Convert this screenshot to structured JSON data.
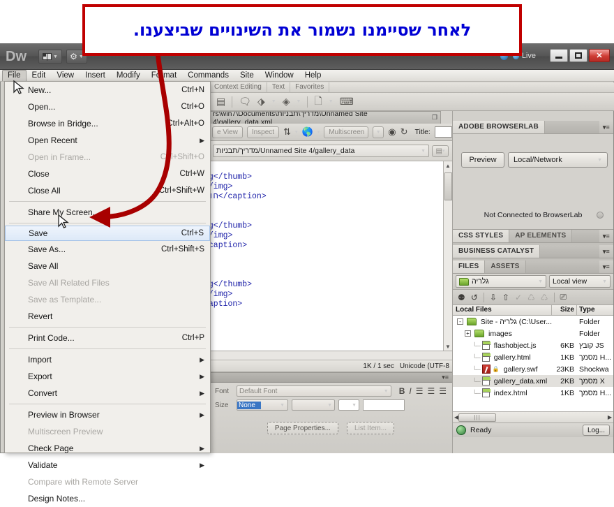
{
  "callout": {
    "text": "לאחר שסיימנו נשמור את השינויים שביצענו."
  },
  "titlebar": {
    "app_abbrev": "Dw",
    "layout_label": "",
    "live_label": "Live",
    "minimize": "",
    "maximize": "",
    "close": "✕"
  },
  "menubar": {
    "items": [
      {
        "label": "File",
        "active": true
      },
      {
        "label": "Edit",
        "active": false
      },
      {
        "label": "View",
        "active": false
      },
      {
        "label": "Insert",
        "active": false
      },
      {
        "label": "Modify",
        "active": false
      },
      {
        "label": "Format",
        "active": false
      },
      {
        "label": "Commands",
        "active": false
      },
      {
        "label": "Site",
        "active": false
      },
      {
        "label": "Window",
        "active": false
      },
      {
        "label": "Help",
        "active": false
      }
    ]
  },
  "file_menu": {
    "items": [
      {
        "label": "New...",
        "accel": "Ctrl+N",
        "disabled": false,
        "submenu": false,
        "selected": false
      },
      {
        "label": "Open...",
        "accel": "Ctrl+O",
        "disabled": false,
        "submenu": false,
        "selected": false
      },
      {
        "label": "Browse in Bridge...",
        "accel": "Ctrl+Alt+O",
        "disabled": false,
        "submenu": false,
        "selected": false
      },
      {
        "label": "Open Recent",
        "accel": "",
        "disabled": false,
        "submenu": true,
        "selected": false
      },
      {
        "label": "Open in Frame...",
        "accel": "Ctrl+Shift+O",
        "disabled": true,
        "submenu": false,
        "selected": false
      },
      {
        "label": "Close",
        "accel": "Ctrl+W",
        "disabled": false,
        "submenu": false,
        "selected": false
      },
      {
        "label": "Close All",
        "accel": "Ctrl+Shift+W",
        "disabled": false,
        "submenu": false,
        "selected": false
      },
      {
        "separator": true
      },
      {
        "label": "Share My Screen...",
        "accel": "",
        "disabled": false,
        "submenu": false,
        "selected": false
      },
      {
        "separator": true
      },
      {
        "label": "Save",
        "accel": "Ctrl+S",
        "disabled": false,
        "submenu": false,
        "selected": true
      },
      {
        "label": "Save As...",
        "accel": "Ctrl+Shift+S",
        "disabled": false,
        "submenu": false,
        "selected": false
      },
      {
        "label": "Save All",
        "accel": "",
        "disabled": false,
        "submenu": false,
        "selected": false
      },
      {
        "label": "Save All Related Files",
        "accel": "",
        "disabled": true,
        "submenu": false,
        "selected": false
      },
      {
        "label": "Save as Template...",
        "accel": "",
        "disabled": true,
        "submenu": false,
        "selected": false
      },
      {
        "label": "Revert",
        "accel": "",
        "disabled": false,
        "submenu": false,
        "selected": false
      },
      {
        "separator": true
      },
      {
        "label": "Print Code...",
        "accel": "Ctrl+P",
        "disabled": false,
        "submenu": false,
        "selected": false
      },
      {
        "separator": true
      },
      {
        "label": "Import",
        "accel": "",
        "disabled": false,
        "submenu": true,
        "selected": false
      },
      {
        "label": "Export",
        "accel": "",
        "disabled": false,
        "submenu": true,
        "selected": false
      },
      {
        "label": "Convert",
        "accel": "",
        "disabled": false,
        "submenu": true,
        "selected": false
      },
      {
        "separator": true
      },
      {
        "label": "Preview in Browser",
        "accel": "",
        "disabled": false,
        "submenu": true,
        "selected": false
      },
      {
        "label": "Multiscreen Preview",
        "accel": "",
        "disabled": true,
        "submenu": false,
        "selected": false
      },
      {
        "label": "Check Page",
        "accel": "",
        "disabled": false,
        "submenu": true,
        "selected": false
      },
      {
        "label": "Validate",
        "accel": "",
        "disabled": false,
        "submenu": true,
        "selected": false
      },
      {
        "label": "Compare with Remote Server",
        "accel": "",
        "disabled": true,
        "submenu": false,
        "selected": false
      },
      {
        "label": "Design Notes...",
        "accel": "",
        "disabled": false,
        "submenu": false,
        "selected": false
      }
    ]
  },
  "insert_bar": {
    "tabs": [
      "Context Editing",
      "Text",
      "Favorites"
    ]
  },
  "document": {
    "tab_path": "rs\\win7\\Documents\\מדריך\\תבניות\\Unnamed Site 4\\gallery_data.xml",
    "toolbar": {
      "live_view": "e View",
      "inspect": "Inspect",
      "multiscreen": "Multiscreen",
      "title_label": "Title:",
      "title_value": ""
    },
    "path_combo": "מדריך/תבניות/Unnamed Site 4/gallery_data",
    "code": "pg</thumb>\n</img>\nחוף</caption>\n\n\npg</thumb>\n</img>\n/caption>\n\n\n\npg</thumb>\n</img>\ncaption>",
    "status": {
      "size_time": "1K / 1 sec",
      "encoding": "Unicode (UTF-8"
    }
  },
  "properties": {
    "font_label": "Font",
    "font_value": "Default Font",
    "size_label": "Size",
    "size_value": "None",
    "page_properties_btn": "Page Properties...",
    "list_item_btn": "List Item..."
  },
  "browserlab": {
    "panel_title": "ADOBE BROWSERLAB",
    "preview_btn": "Preview",
    "mode_value": "Local/Network",
    "status": "Not Connected to BrowserLab"
  },
  "panels": {
    "css_styles": "CSS STYLES",
    "ap_elements": "AP ELEMENTS",
    "business_catalyst": "BUSINESS CATALYST",
    "files_tab": "FILES",
    "assets_tab": "ASSETS"
  },
  "files_panel": {
    "site_value": "גלריה",
    "view_value": "Local view",
    "columns": {
      "name": "Local Files",
      "size": "Size",
      "type": "Type"
    },
    "rows": [
      {
        "name": "Site - גלריה (C:\\User...",
        "size": "",
        "type": "Folder",
        "icon": "folder-icon",
        "indent": 0,
        "expander": "-",
        "selected": false
      },
      {
        "name": "images",
        "size": "",
        "type": "Folder",
        "icon": "folder-icon",
        "indent": 1,
        "expander": "+",
        "selected": false
      },
      {
        "name": "flashobject.js",
        "size": "6KB",
        "type": "קובץ JS",
        "icon": "file-icon",
        "indent": 2,
        "expander": "",
        "selected": false
      },
      {
        "name": "gallery.html",
        "size": "1KB",
        "type": "מסמך H...",
        "icon": "file-icon",
        "indent": 2,
        "expander": "",
        "selected": false
      },
      {
        "name": "gallery.swf",
        "size": "23KB",
        "type": "Shockwa",
        "icon": "swf-icon",
        "indent": 2,
        "expander": "",
        "selected": false
      },
      {
        "name": "gallery_data.xml",
        "size": "2KB",
        "type": "מסמך X",
        "icon": "file-icon",
        "indent": 2,
        "expander": "",
        "selected": true
      },
      {
        "name": "index.html",
        "size": "1KB",
        "type": "מסמך H...",
        "icon": "file-icon",
        "indent": 2,
        "expander": "",
        "selected": false
      }
    ]
  },
  "statusbar": {
    "message": "Ready",
    "log_btn": "Log..."
  },
  "colors": {
    "callout_border": "#c00000",
    "callout_text": "#0000d4",
    "arrow": "#a80000",
    "code_text": "#1b1fa8",
    "selection": "#3a76c4"
  }
}
